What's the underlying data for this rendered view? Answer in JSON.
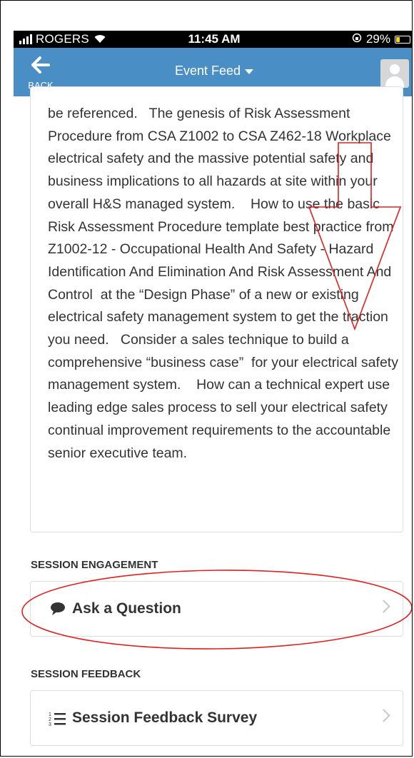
{
  "status": {
    "carrier": "ROGERS",
    "time": "11:45 AM",
    "battery": "29%"
  },
  "nav": {
    "back_label": "BACK",
    "title": "Event Feed"
  },
  "description": "be referenced.   The genesis of Risk Assessment Procedure from CSA Z1002 to CSA Z462-18 Workplace electrical safety and the massive potential safety and business implications to all hazards at site within your overall H&S managed system.    How to use the basic Risk Assessment Procedure template best practice from Z1002-12 - Occupational Health And Safety - Hazard Identification And Elimination And Risk Assessment And Control  at the “Design Phase” of a new or existing electrical safety management system to get the traction you need.   Consider a sales technique to build a comprehensive “business case”  for your electrical safety management system.    How can a technical expert use leading edge sales process to sell your electrical safety continual improvement requirements to the accountable senior executive team.",
  "engagement": {
    "header": "SESSION ENGAGEMENT",
    "ask_label": "Ask a Question"
  },
  "feedback": {
    "header": "SESSION FEEDBACK",
    "survey_label": "Session Feedback Survey"
  },
  "colors": {
    "nav": "#4a8ec6",
    "annotation": "#e02020",
    "battery": "#ffd400"
  },
  "icons": {
    "back": "arrow-left-icon",
    "caret": "caret-down-icon",
    "avatar": "user-icon",
    "ask": "speech-bubble-icon",
    "survey": "numbered-list-icon",
    "chevron": "chevron-right-icon"
  }
}
